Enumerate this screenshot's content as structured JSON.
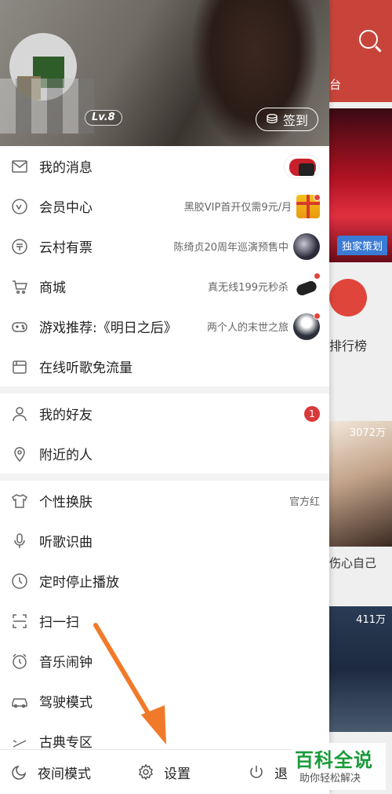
{
  "background_app": {
    "tab_partial": "台",
    "banner_tag": "独家策划",
    "rank_label": "排行榜",
    "card1_count": "3072万",
    "card1_title": "伤心自己",
    "card2_count": "411万"
  },
  "profile": {
    "level": "Lv.8",
    "checkin_label": "签到"
  },
  "menu_section1": [
    {
      "label": "我的消息",
      "icon": "mail-icon",
      "right_text": ""
    },
    {
      "label": "会员中心",
      "icon": "vip-icon",
      "right_text": "黑胶VIP首开仅需9元/月"
    },
    {
      "label": "云村有票",
      "icon": "ticket-icon",
      "right_text": "陈绮贞20周年巡演预售中"
    },
    {
      "label": "商城",
      "icon": "cart-icon",
      "right_text": "真无线199元秒杀"
    },
    {
      "label": "游戏推荐:《明日之后》",
      "icon": "gamepad-icon",
      "right_text": "两个人的末世之旅"
    },
    {
      "label": "在线听歌免流量",
      "icon": "sim-card-icon",
      "right_text": ""
    }
  ],
  "menu_section2": [
    {
      "label": "我的好友",
      "icon": "user-icon",
      "badge": "1"
    },
    {
      "label": "附近的人",
      "icon": "location-icon"
    }
  ],
  "menu_section3": [
    {
      "label": "个性换肤",
      "icon": "shirt-icon",
      "right_text": "官方红"
    },
    {
      "label": "听歌识曲",
      "icon": "mic-icon"
    },
    {
      "label": "定时停止播放",
      "icon": "clock-icon"
    },
    {
      "label": "扫一扫",
      "icon": "scan-icon"
    },
    {
      "label": "音乐闹钟",
      "icon": "alarm-icon"
    },
    {
      "label": "驾驶模式",
      "icon": "car-icon"
    },
    {
      "label": "古典专区",
      "icon": "classical-icon"
    }
  ],
  "footer": {
    "night_mode": "夜间模式",
    "settings": "设置",
    "exit": "退"
  },
  "watermark": {
    "title": "百科全说",
    "subtitle": "助你轻松解决"
  },
  "colors": {
    "accent_red": "#d9393b",
    "arrow_orange": "#f07a2a",
    "watermark_green": "#1a9b3a"
  }
}
